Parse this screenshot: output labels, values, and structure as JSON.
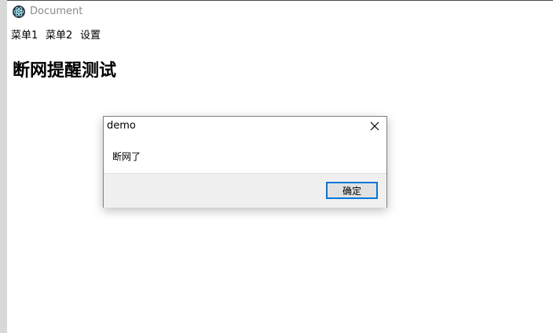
{
  "window": {
    "title": "Document"
  },
  "menu": {
    "items": [
      {
        "label": "菜单1"
      },
      {
        "label": "菜单2"
      },
      {
        "label": "设置"
      }
    ]
  },
  "page": {
    "heading": "断网提醒测试"
  },
  "dialog": {
    "title": "demo",
    "message": "断网了",
    "ok_label": "确定"
  },
  "colors": {
    "accent": "#0078d7",
    "footer_bg": "#f0f0f0"
  }
}
